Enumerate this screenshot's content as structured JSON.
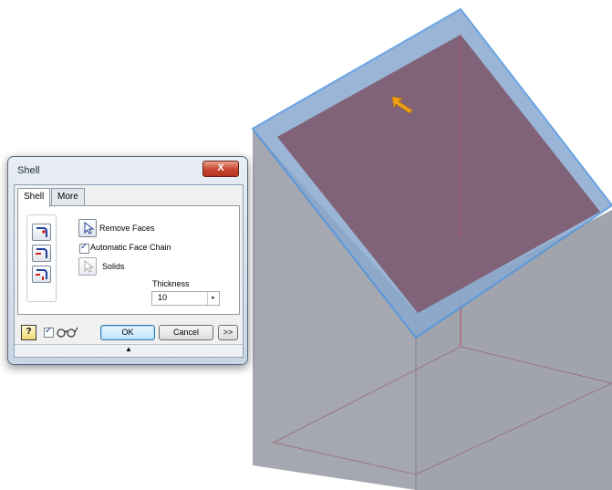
{
  "dialog": {
    "title": "Shell",
    "close_label": "X",
    "tabs": [
      {
        "label": "Shell",
        "active": true
      },
      {
        "label": "More",
        "active": false
      }
    ],
    "remove_faces_label": "Remove Faces",
    "auto_face_chain_label": "Automatic Face Chain",
    "auto_face_chain_checked": true,
    "solids_label": "Solids",
    "thickness_label": "Thickness",
    "thickness_value": "10",
    "help_label": "?",
    "preview_checked": true,
    "ok_label": "OK",
    "cancel_label": "Cancel",
    "more_label": ">>",
    "expand_glyph": "▲"
  },
  "viewport": {
    "face_color": "#7e5c70",
    "edge_color": "#4f95df",
    "cursor_color": "#f0a318"
  }
}
